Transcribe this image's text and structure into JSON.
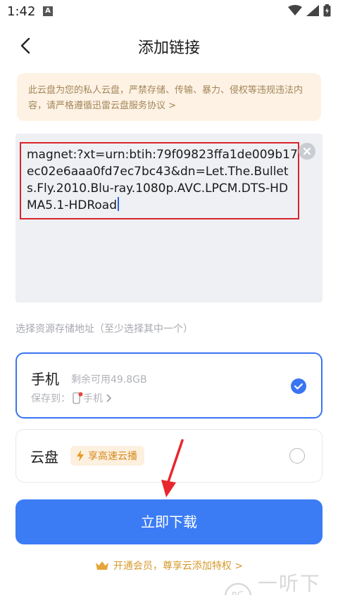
{
  "status_bar": {
    "time": "1:42",
    "notif_letter": "A"
  },
  "nav": {
    "title": "添加链接"
  },
  "notice": {
    "text": "此云盘为您的私人云盘，严禁存储、传输、暴力、侵权等违规违法内容，请严格遵循",
    "link": "迅雷云盘服务协议 >"
  },
  "link_input": {
    "value": "magnet:?xt=urn:btih:79f09823ffa1de009b17ec02e6aaa0fd7ec7bc43&dn=Let.The.Bullets.Fly.2010.Blu-ray.1080p.AVC.LPCM.DTS-HDMA5.1-HDRoad"
  },
  "storage": {
    "hint": "选择资源存储地址（至少选择其中一个）",
    "phone": {
      "title": "手机",
      "space": "剩余可用49.8GB",
      "save_prefix": "保存到：",
      "save_target": "手机",
      "selected": true
    },
    "cloud": {
      "title": "云盘",
      "tag": "享高速云播",
      "selected": false
    }
  },
  "actions": {
    "download": "立即下载",
    "vip": "开通会员，尊享云添加特权 >"
  },
  "watermark": {
    "text": "一听下载",
    "glyph": "听"
  },
  "colors": {
    "primary": "#3b7cf5",
    "notice_bg": "#fdf2e4",
    "notice_text": "#a3865a",
    "highlight_border": "#d9232a",
    "vip_gold": "#d69a2e"
  }
}
